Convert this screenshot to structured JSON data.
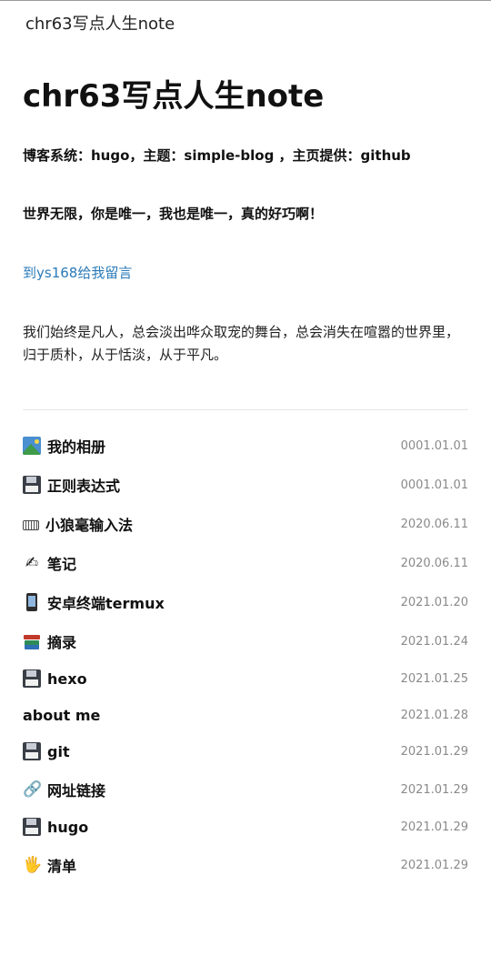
{
  "site": {
    "name": "chr63写点人生note"
  },
  "page": {
    "title": "chr63写点人生note",
    "meta": "博客系统：hugo，主题：simple-blog ，主页提供：github",
    "tagline": "世界无限，你是唯一，我也是唯一，真的好巧啊！",
    "guestbook_link": "到ys168给我留言",
    "intro": "我们始终是凡人，总会淡出哗众取宠的舞台，总会消失在喧嚣的世界里，归于质朴，从于恬淡，从于平凡。"
  },
  "colors": {
    "link": "#2a7ab8",
    "date": "#8a8a8a",
    "text": "#111111"
  },
  "posts": [
    {
      "icon": "photo-album-icon",
      "title": "我的相册",
      "date": "0001.01.01"
    },
    {
      "icon": "floppy-disk-icon",
      "title": "正则表达式",
      "date": "0001.01.01"
    },
    {
      "icon": "keyboard-icon",
      "title": "小狼毫输入法",
      "date": "2020.06.11"
    },
    {
      "icon": "writing-hand-icon",
      "title": "笔记",
      "date": "2020.06.11"
    },
    {
      "icon": "mobile-phone-icon",
      "title": "安卓终端termux",
      "date": "2021.01.20"
    },
    {
      "icon": "books-icon",
      "title": "摘录",
      "date": "2021.01.24"
    },
    {
      "icon": "floppy-disk-icon",
      "title": "hexo",
      "date": "2021.01.25"
    },
    {
      "icon": "",
      "title": "about me",
      "date": "2021.01.28"
    },
    {
      "icon": "floppy-disk-icon",
      "title": "git",
      "date": "2021.01.29"
    },
    {
      "icon": "link-icon",
      "title": "网址链接",
      "date": "2021.01.29"
    },
    {
      "icon": "floppy-disk-icon",
      "title": "hugo",
      "date": "2021.01.29"
    },
    {
      "icon": "raised-hand-icon",
      "title": "清单",
      "date": "2021.01.29"
    }
  ]
}
